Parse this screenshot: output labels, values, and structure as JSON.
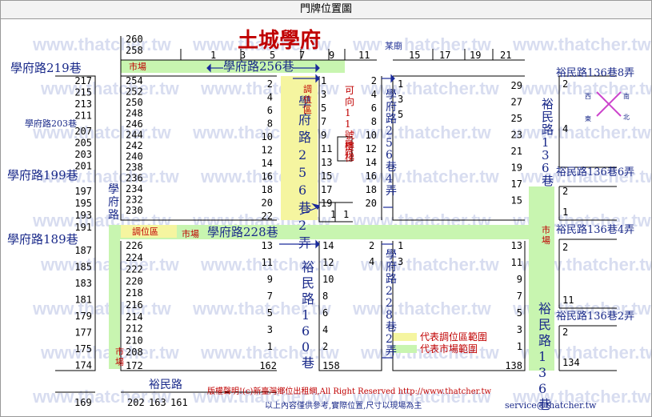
{
  "window_title": "門牌位置圖",
  "map_title": "土城學府",
  "watermark": "www.thatcher.tw",
  "colors": {
    "market": "#c8f5b0",
    "adjust": "#f5f5a0",
    "road_label": "#1a2a8a",
    "red": "#c00000",
    "arrow": "#1a2a9a"
  },
  "roads": {
    "lane256": "學府路256巷",
    "lane228": "學府路228巷",
    "lane219": "學府路219巷",
    "lane203": "學府路203巷",
    "lane199": "學府路199巷",
    "lane189": "學府路189巷",
    "xuefu_road": "學府路",
    "lane256_2": "學府路256巷2弄",
    "lane256_4": "學府路256巷4弄",
    "lane228_2": "學府路228巷2弄",
    "yumin160": "裕民路160巷",
    "yumin136": "裕民路136巷",
    "yumin_road": "裕民路",
    "y136_8": "裕民路136巷8弄",
    "y136_6": "裕民路136巷6弄",
    "y136_4": "裕民路136巷4弄",
    "y136_2": "裕民路136巷2弄"
  },
  "labels": {
    "market": "市場",
    "adjust": "調位區",
    "adjust_v": "調位區",
    "ke_xiang": "可向11號樓梯",
    "shrine": "廟府",
    "shrine_top": "某廟",
    "compass": {
      "n": "北",
      "s": "南",
      "e": "東",
      "w": "西"
    },
    "legend_adjust": "代表調位區範圍",
    "legend_market": "代表市場範圍",
    "copyright": "版權聲明!(c)新臺灣鄉位出租網,All Right Reserved http://www.thatcher.tw",
    "note": "以上內容僅供參考,實際位置,尺寸以現場為主",
    "email": "service@thatcher.tw"
  },
  "numbers": {
    "top_row": [
      "1",
      "3",
      "5",
      "7",
      "9",
      "11",
      "15",
      "17",
      "19",
      "21"
    ],
    "col_left_outer": [
      "217",
      "215",
      "213",
      "211",
      "207",
      "205",
      "203",
      "201",
      "197",
      "195",
      "193",
      "191",
      "187",
      "185",
      "183",
      "181",
      "179",
      "177",
      "175",
      "174"
    ],
    "col_a_top": [
      "260",
      "258",
      "254",
      "252",
      "250",
      "248",
      "246",
      "244",
      "242",
      "240",
      "238",
      "236",
      "234",
      "232",
      "230"
    ],
    "col_a_top_right": [
      "2",
      "4",
      "6",
      "8",
      "10",
      "12",
      "14",
      "16",
      "18",
      "20",
      "22"
    ],
    "col_b_left": [
      "1",
      "3",
      "5",
      "7",
      "9",
      "11",
      "13",
      "15",
      "17",
      "19"
    ],
    "col_b_mid": [
      "2",
      "4",
      "6",
      "8",
      "10",
      "12",
      "14",
      "16",
      "18",
      "20"
    ],
    "col_b_bottom": [
      "1",
      "1"
    ],
    "col_c_left": [
      "1",
      "3",
      "5"
    ],
    "col_c_right": [
      "29",
      "27",
      "25",
      "23",
      "21",
      "19",
      "17",
      "15"
    ],
    "col_a_bot": [
      "226",
      "224",
      "222",
      "220",
      "218",
      "216",
      "214",
      "212",
      "210",
      "208",
      "172"
    ],
    "col_a_bot_right": [
      "13",
      "11",
      "9",
      "7",
      "5",
      "3",
      "1",
      "162"
    ],
    "col_d_left": [
      "14",
      "12",
      "10",
      "8",
      "6",
      "4",
      "2",
      "158"
    ],
    "col_d_right": [
      "2",
      "4"
    ],
    "col_e_left": [
      "1",
      "3"
    ],
    "col_e_right": [
      "13",
      "11",
      "9",
      "7",
      "5",
      "3",
      "1",
      "138"
    ],
    "col_f": [
      "2",
      "4"
    ],
    "col_g": [
      "2",
      "1"
    ],
    "col_h": [
      "2",
      "11"
    ],
    "col_i": [
      "2",
      "134"
    ],
    "bottom_row": [
      "169",
      "202",
      "163",
      "161"
    ]
  }
}
